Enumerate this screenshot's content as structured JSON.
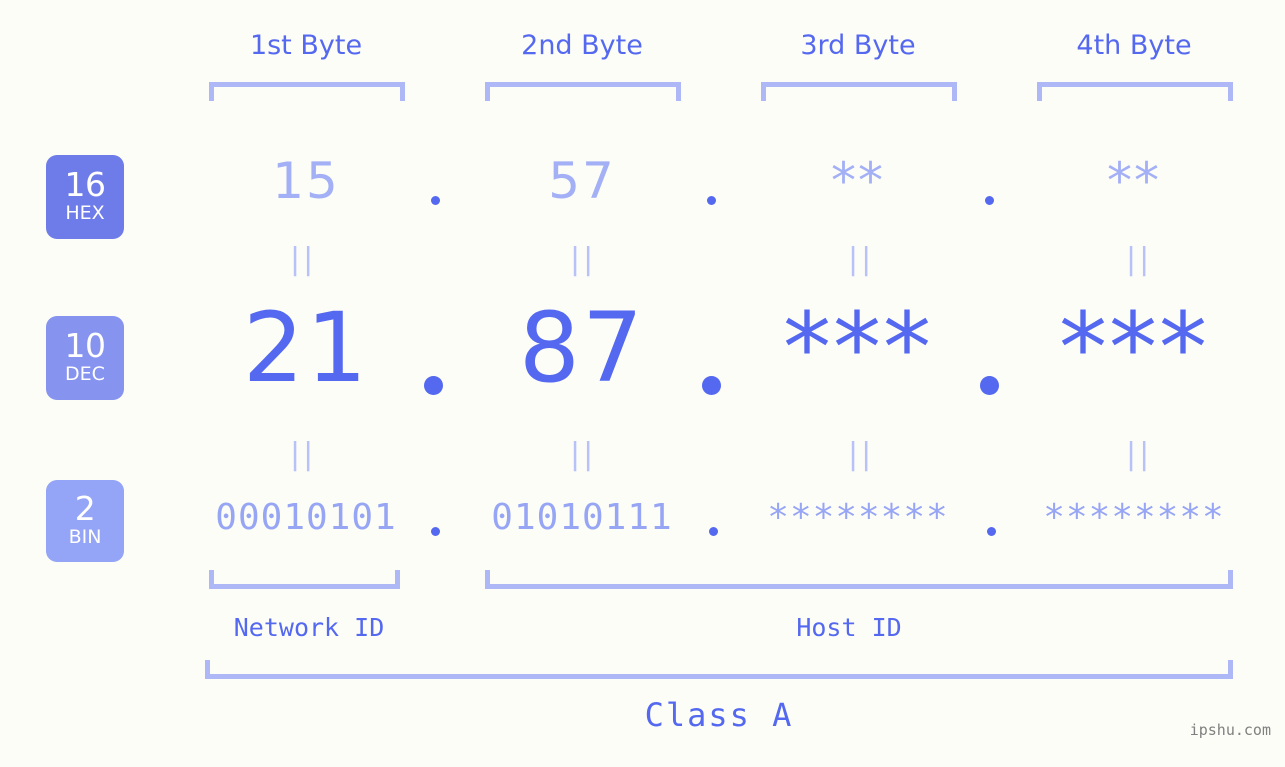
{
  "colors": {
    "background": "#fcfdf7",
    "primary_blue": "#5468f0",
    "light_blue": "#a3b0f6",
    "bracket_blue": "#aeb8f7",
    "badge_hex": "#6e7ce9",
    "badge_dec": "#8693ef",
    "badge_bin": "#94a4f6",
    "watermark_gray": "#808080"
  },
  "byte_headers": [
    {
      "label": "1st Byte"
    },
    {
      "label": "2nd Byte"
    },
    {
      "label": "3rd Byte"
    },
    {
      "label": "4th Byte"
    }
  ],
  "bases": [
    {
      "number": "16",
      "name": "HEX"
    },
    {
      "number": "10",
      "name": "DEC"
    },
    {
      "number": "2",
      "name": "BIN"
    }
  ],
  "rows": {
    "hex": {
      "base_number": "16",
      "base_name": "HEX",
      "values": [
        "15",
        "57",
        "**",
        "**"
      ]
    },
    "dec": {
      "base_number": "10",
      "base_name": "DEC",
      "values": [
        "21",
        "87",
        "***",
        "***"
      ]
    },
    "bin": {
      "base_number": "2",
      "base_name": "BIN",
      "values": [
        "00010101",
        "01010111",
        "********",
        "********"
      ]
    }
  },
  "separators": {
    "dot": ".",
    "equals": "||"
  },
  "regions": [
    {
      "label": "Network ID"
    },
    {
      "label": "Host ID"
    }
  ],
  "class_label": "Class A",
  "watermark": "ipshu.com"
}
